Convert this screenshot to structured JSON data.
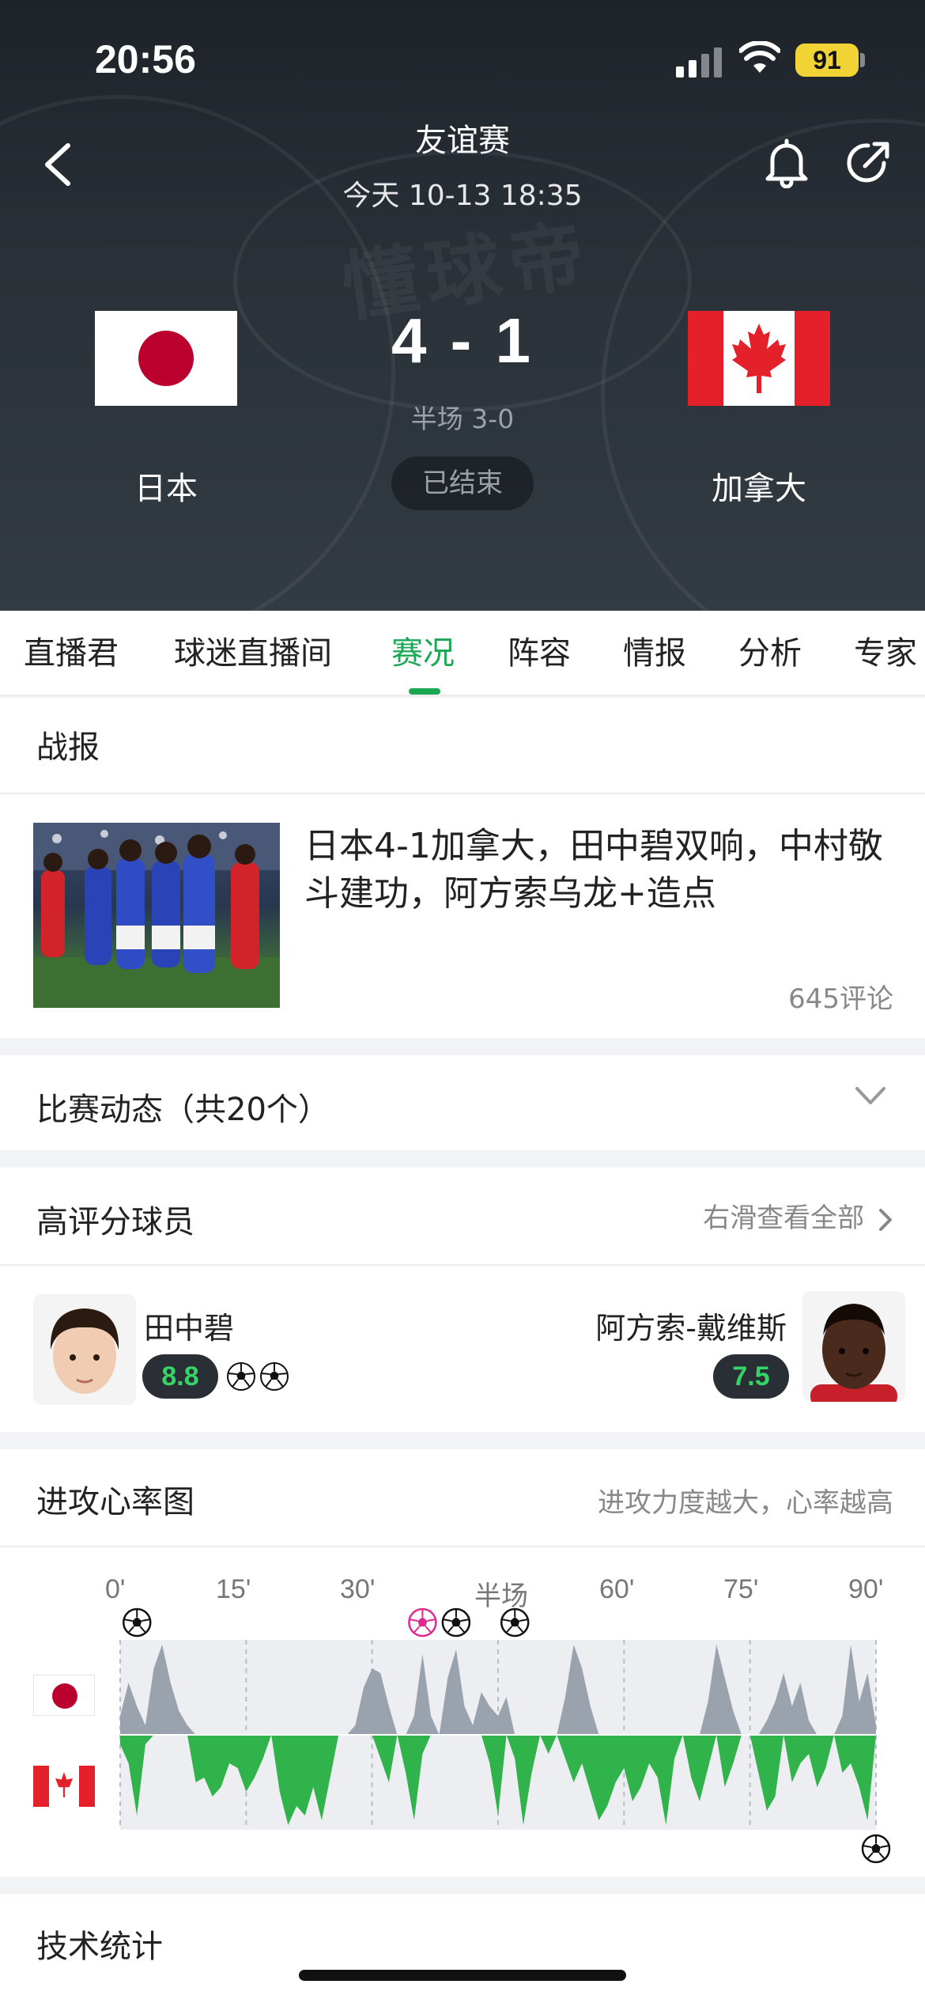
{
  "status_bar": {
    "time": "20:56",
    "battery": "91"
  },
  "header": {
    "competition": "友谊赛",
    "datetime": "今天 10-13 18:35",
    "home_team": "日本",
    "away_team": "加拿大",
    "score": "4 - 1",
    "halftime": "半场 3-0",
    "status": "已结束",
    "watermark": "懂球帝"
  },
  "tabs": [
    "直播君",
    "球迷直播间",
    "赛况",
    "阵容",
    "情报",
    "分析",
    "专家"
  ],
  "active_tab": "赛况",
  "news": {
    "section_title": "战报",
    "headline": "日本4-1加拿大，田中碧双响，中村敬斗建功，阿方索乌龙+造点",
    "comments": "645评论"
  },
  "events": {
    "title": "比赛动态（共20个）"
  },
  "top_players": {
    "title": "高评分球员",
    "more": "右滑查看全部",
    "home": {
      "name": "田中碧",
      "rating": "8.8",
      "goals": 2
    },
    "away": {
      "name": "阿方索-戴维斯",
      "rating": "7.5"
    }
  },
  "heart_rate": {
    "title": "进攻心率图",
    "note": "进攻力度越大，心率越高",
    "axis_labels": [
      "0'",
      "15'",
      "30'",
      "半场",
      "60'",
      "75'",
      "90'"
    ]
  },
  "tech_stats": {
    "title": "技术统计"
  },
  "colors": {
    "accent": "#1aa854",
    "rating_text": "#34d467",
    "home_wave": "#9aa3ad",
    "away_wave": "#2fb34a"
  },
  "chart_data": {
    "type": "area",
    "title": "进攻心率图",
    "xlabel": "",
    "ylabel": "",
    "x_ticks": [
      "0'",
      "15'",
      "30'",
      "半场",
      "60'",
      "75'",
      "90'"
    ],
    "xlim": [
      0,
      90
    ],
    "ylim": [
      -1,
      1
    ],
    "series": [
      {
        "name": "日本",
        "x": [
          0,
          1,
          2,
          3,
          4,
          5,
          6,
          7,
          8,
          9,
          10,
          11,
          12,
          13,
          14,
          15,
          16,
          17,
          18,
          19,
          20,
          21,
          22,
          23,
          24,
          25,
          26,
          27,
          28,
          29,
          30,
          31,
          32,
          33,
          34,
          35,
          36,
          37,
          38,
          39,
          40,
          41,
          42,
          43,
          44,
          45,
          46,
          47,
          48,
          49,
          50,
          51,
          52,
          53,
          54,
          55,
          56,
          57,
          58,
          59,
          60,
          61,
          62,
          63,
          64,
          65,
          66,
          67,
          68,
          69,
          70,
          71,
          72,
          73,
          74,
          75,
          76,
          77,
          78,
          79,
          80,
          81,
          82,
          83,
          84,
          85,
          86,
          87,
          88,
          89,
          90
        ],
        "values": [
          0.2,
          0.55,
          0.3,
          0.1,
          0.7,
          0.95,
          0.55,
          0.25,
          0.1,
          0,
          0,
          0,
          0,
          0,
          0,
          0,
          0,
          0,
          0,
          0,
          0,
          0,
          0,
          0,
          0,
          0,
          0,
          0,
          0.1,
          0.5,
          0.7,
          0.65,
          0.3,
          0,
          0,
          0.2,
          0.85,
          0.2,
          0,
          0.6,
          0.9,
          0.3,
          0.1,
          0.45,
          0.3,
          0.2,
          0.4,
          0,
          0,
          0,
          0,
          0,
          0,
          0.4,
          0.95,
          0.7,
          0.3,
          0,
          0,
          0,
          0,
          0,
          0,
          0,
          0,
          0,
          0,
          0,
          0,
          0,
          0.35,
          0.95,
          0.6,
          0.25,
          0,
          0,
          0,
          0.15,
          0.35,
          0.65,
          0.3,
          0.55,
          0.15,
          0,
          0,
          0,
          0.2,
          0.95,
          0.35,
          0.65,
          0.1
        ]
      },
      {
        "name": "加拿大",
        "x": [
          0,
          1,
          2,
          3,
          4,
          5,
          6,
          7,
          8,
          9,
          10,
          11,
          12,
          13,
          14,
          15,
          16,
          17,
          18,
          19,
          20,
          21,
          22,
          23,
          24,
          25,
          26,
          27,
          28,
          29,
          30,
          31,
          32,
          33,
          34,
          35,
          36,
          37,
          38,
          39,
          40,
          41,
          42,
          43,
          44,
          45,
          46,
          47,
          48,
          49,
          50,
          51,
          52,
          53,
          54,
          55,
          56,
          57,
          58,
          59,
          60,
          61,
          62,
          63,
          64,
          65,
          66,
          67,
          68,
          69,
          70,
          71,
          72,
          73,
          74,
          75,
          76,
          77,
          78,
          79,
          80,
          81,
          82,
          83,
          84,
          85,
          86,
          87,
          88,
          89,
          90
        ],
        "values": [
          -0.1,
          -0.3,
          -0.85,
          -0.1,
          0,
          0,
          0,
          0,
          0,
          -0.5,
          -0.45,
          -0.65,
          -0.55,
          -0.3,
          -0.35,
          -0.6,
          -0.45,
          -0.25,
          0,
          -0.6,
          -0.95,
          -0.75,
          -0.85,
          -0.55,
          -0.9,
          -0.45,
          0,
          0,
          0,
          0,
          0,
          -0.25,
          -0.5,
          0,
          -0.4,
          -0.9,
          -0.2,
          0,
          0,
          0,
          0,
          0,
          0,
          0,
          -0.3,
          -0.85,
          0,
          -0.25,
          -0.95,
          -0.4,
          0,
          -0.2,
          0,
          -0.25,
          -0.5,
          -0.3,
          -0.6,
          -0.9,
          -0.75,
          -0.5,
          -0.35,
          -0.7,
          -0.55,
          -0.3,
          -0.45,
          -0.95,
          -0.25,
          0,
          -0.45,
          -0.7,
          -0.35,
          0,
          -0.55,
          -0.3,
          0,
          0,
          -0.4,
          -0.8,
          -0.65,
          0,
          -0.5,
          -0.3,
          -0.2,
          -0.55,
          -0.35,
          0,
          -0.4,
          -0.3,
          -0.55,
          -0.9,
          0
        ]
      }
    ],
    "events": [
      {
        "team": "日本",
        "minute": 2,
        "type": "goal"
      },
      {
        "team": "日本",
        "minute": 36,
        "type": "own-goal"
      },
      {
        "team": "日本",
        "minute": 40,
        "type": "goal"
      },
      {
        "team": "日本",
        "minute": 47,
        "type": "goal"
      },
      {
        "team": "加拿大",
        "minute": 90,
        "type": "goal"
      }
    ],
    "grid": true,
    "legend": "left"
  }
}
